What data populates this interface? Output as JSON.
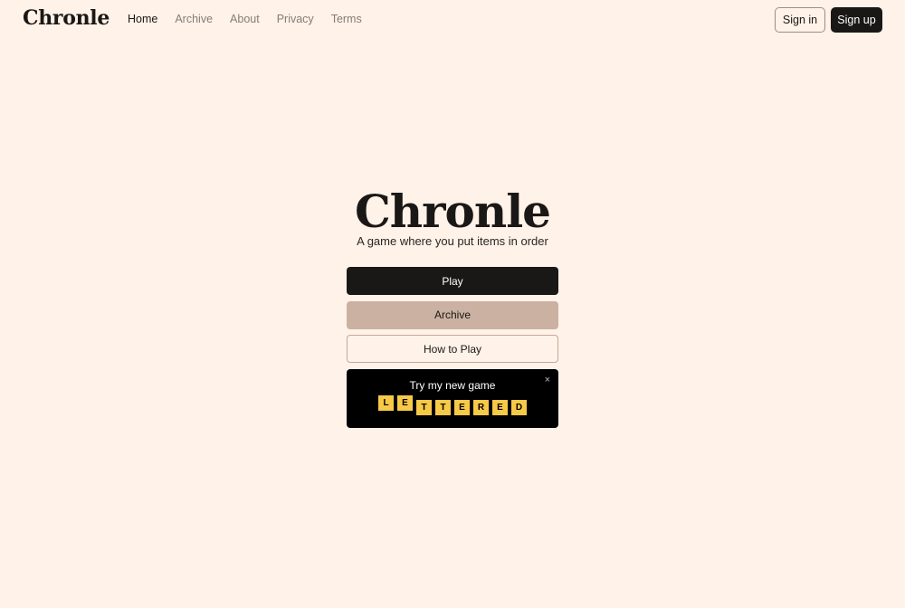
{
  "header": {
    "logo": "Chronle",
    "nav": [
      {
        "label": "Home",
        "active": true
      },
      {
        "label": "Archive",
        "active": false
      },
      {
        "label": "About",
        "active": false
      },
      {
        "label": "Privacy",
        "active": false
      },
      {
        "label": "Terms",
        "active": false
      }
    ],
    "signin_label": "Sign in",
    "signup_label": "Sign up"
  },
  "hero": {
    "title": "Chronle",
    "subtitle": "A game where you put items in order"
  },
  "menu": {
    "play_label": "Play",
    "archive_label": "Archive",
    "howto_label": "How to Play"
  },
  "promo": {
    "text": "Try my new game",
    "close_glyph": "×",
    "tiles": [
      "L",
      "E",
      "T",
      "T",
      "E",
      "R",
      "E",
      "D"
    ]
  },
  "colors": {
    "background": "#fff2e8",
    "primary": "#1a1816",
    "archive_button": "#cbb1a1",
    "tile": "#f7c948"
  }
}
